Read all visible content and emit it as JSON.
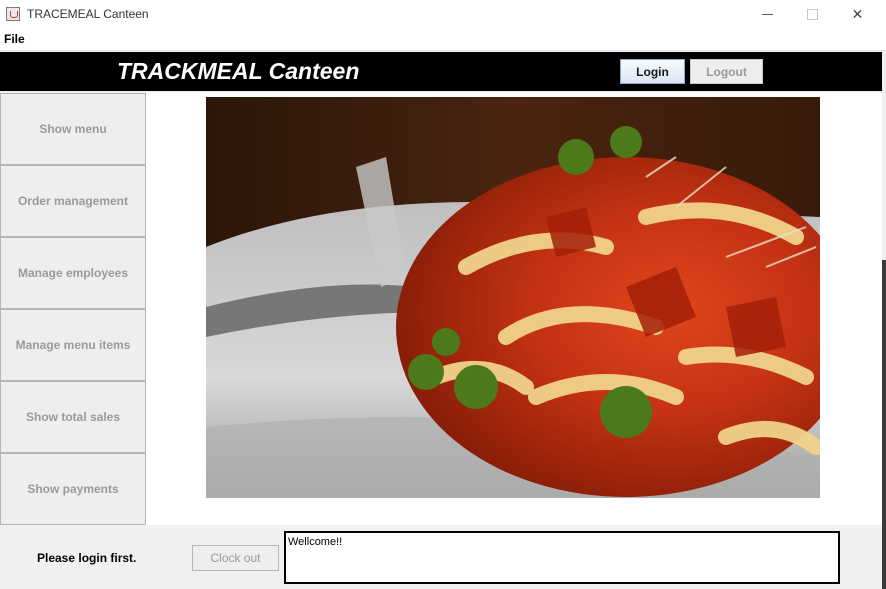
{
  "window": {
    "title": "TRACEMEAL Canteen"
  },
  "menubar": {
    "items": [
      "File"
    ]
  },
  "header": {
    "brand": "TRACKMEAL Canteen",
    "login_label": "Login",
    "logout_label": "Logout"
  },
  "sidebar": {
    "items": [
      {
        "label": "Show menu"
      },
      {
        "label": "Order management"
      },
      {
        "label": "Manage employees"
      },
      {
        "label": "Manage menu items"
      },
      {
        "label": "Show total sales"
      },
      {
        "label": "Show payments"
      }
    ]
  },
  "footer": {
    "status": "Please login first.",
    "clock_out_label": "Clock out",
    "message": "Wellcome!!"
  },
  "main": {
    "image": "pasta-dish-photo"
  },
  "colors": {
    "header_bg": "#000000",
    "login_border": "#8aa6c8",
    "disabled_text": "#9a9a9a"
  }
}
